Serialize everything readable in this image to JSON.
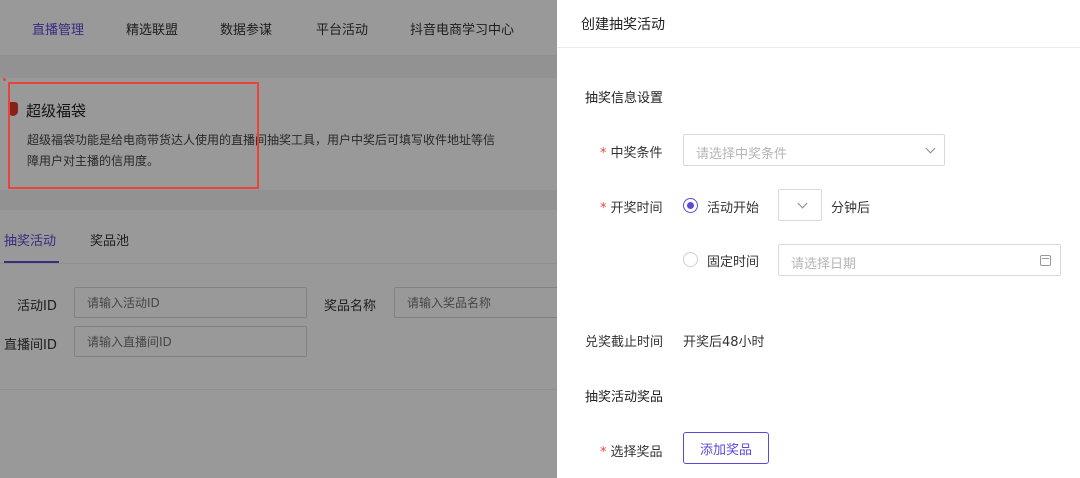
{
  "nav": {
    "items": [
      {
        "label": "直播管理",
        "active": true
      },
      {
        "label": "精选联盟",
        "active": false
      },
      {
        "label": "数据参谋",
        "active": false
      },
      {
        "label": "平台活动",
        "active": false
      },
      {
        "label": "抖音电商学习中心",
        "active": false
      }
    ]
  },
  "intro": {
    "title": "超级福袋",
    "desc_line1": "超级福袋功能是给电商带货达人使用的直播间抽奖工具，用户中奖后可填写收件地址等信",
    "desc_line2": "障用户对主播的信用度。"
  },
  "tabs": {
    "items": [
      {
        "label": "抽奖活动",
        "active": true
      },
      {
        "label": "奖品池",
        "active": false
      }
    ]
  },
  "filters": {
    "activity_id_label": "活动ID",
    "activity_id_placeholder": "请输入活动ID",
    "prize_name_label": "奖品名称",
    "prize_name_placeholder": "请输入奖品名称",
    "room_id_label": "直播间ID",
    "room_id_placeholder": "请输入直播间ID"
  },
  "drawer": {
    "title": "创建抽奖活动",
    "section_info": "抽奖信息设置",
    "win_condition_label": "中奖条件",
    "win_condition_placeholder": "请选择中奖条件",
    "draw_time_label": "开奖时间",
    "option_activity_start": "活动开始",
    "minutes_after": "分钟后",
    "option_fixed_time": "固定时间",
    "date_placeholder": "请选择日期",
    "redeem_deadline_label": "兑奖截止时间",
    "redeem_deadline_value": "开奖后48小时",
    "section_prizes": "抽奖活动奖品",
    "select_prize_label": "选择奖品",
    "add_prize_button": "添加奖品",
    "required_mark": "*"
  },
  "colors": {
    "accent": "#5a4ad6",
    "required": "#e8443a",
    "highlight_box": "#e8443a"
  },
  "icons": {
    "bag": "lucky-bag-icon",
    "chevron": "chevron-down-icon",
    "calendar": "calendar-icon"
  }
}
